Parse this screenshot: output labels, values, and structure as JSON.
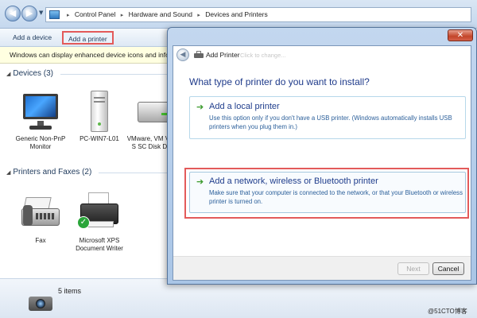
{
  "explorer": {
    "breadcrumbs": [
      "Control Panel",
      "Hardware and Sound",
      "Devices and Printers"
    ],
    "toolbar": {
      "add_device": "Add a device",
      "add_printer": "Add a printer"
    },
    "infobar": "Windows can display enhanced device icons and inform",
    "devices_group": {
      "title": "Devices (3)",
      "items": [
        {
          "label": "Generic Non-PnP Monitor",
          "icon": "monitor-icon"
        },
        {
          "label": "PC-WIN7-L01",
          "icon": "computer-icon"
        },
        {
          "label": "VMware, VM Virtual S SC Disk Devic",
          "icon": "disk-icon"
        }
      ]
    },
    "printers_group": {
      "title": "Printers and Faxes (2)",
      "items": [
        {
          "label": "Fax",
          "icon": "fax-icon"
        },
        {
          "label": "Microsoft XPS Document Writer",
          "icon": "printer-icon",
          "default": true
        }
      ]
    },
    "status": {
      "count": "5 items"
    }
  },
  "dialog": {
    "title": "Add Printer",
    "ghost_text": "Click to change...",
    "question": "What type of printer do you want to install?",
    "options": [
      {
        "title": "Add a local printer",
        "description": "Use this option only if you don't have a USB printer. (Windows automatically installs USB printers when you plug them in.)"
      },
      {
        "title": "Add a network, wireless or Bluetooth printer",
        "description": "Make sure that your computer is connected to the network, or that your Bluetooth or wireless printer is turned on."
      }
    ],
    "buttons": {
      "next": "Next",
      "cancel": "Cancel"
    }
  },
  "watermark": "@51CTO博客",
  "colors": {
    "highlight": "#e35a5a",
    "link_blue": "#1f3d8c",
    "arrow_green": "#3a9a2b"
  }
}
